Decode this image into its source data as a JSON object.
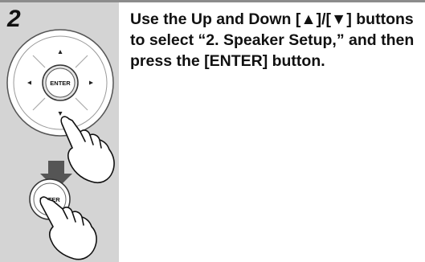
{
  "step": {
    "number": "2",
    "instruction": "Use the Up and Down [▲]/[▼] buttons to select “2. Speaker Setup,” and then press the [ENTER] button."
  },
  "remote": {
    "dpad_center_label": "ENTER",
    "enter_button_label": "ENTER",
    "dpad_icons": [
      "up-arrow-icon",
      "down-arrow-icon",
      "left-arrow-icon",
      "right-arrow-icon"
    ],
    "flow_icon": "down-arrow-icon",
    "hand_icon": "pressing-hand-icon"
  },
  "colors": {
    "panel_bg": "#d4d4d4",
    "rule": "#8c8c8c",
    "text": "#111111"
  }
}
